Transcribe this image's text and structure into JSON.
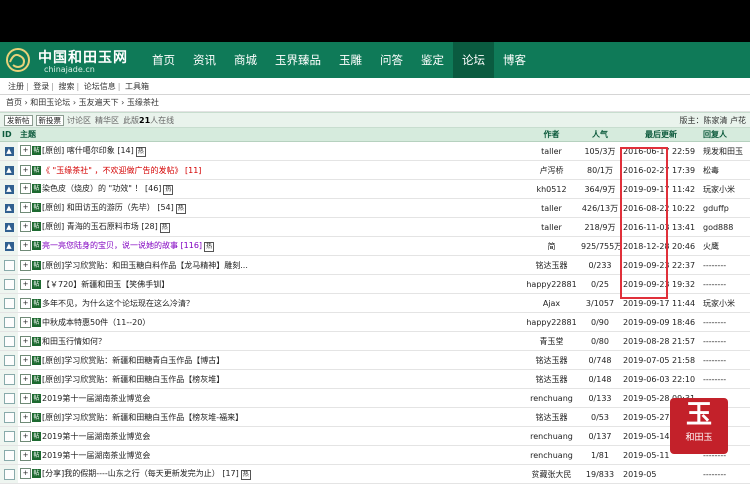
{
  "site": {
    "logo_cn": "中国和田玉网",
    "logo_en": "chinajade.cn"
  },
  "nav": [
    "首页",
    "资讯",
    "商城",
    "玉界臻品",
    "玉雕",
    "问答",
    "鉴定",
    "论坛",
    "博客"
  ],
  "subnav": [
    "注册",
    "登录",
    "搜索",
    "论坛信息",
    "工具箱"
  ],
  "breadcrumb": "首页 › 和田玉论坛 › 玉友遍天下 › 玉缘茶社",
  "toolbar": {
    "new_post": "发新帖",
    "new_vote": "新投票",
    "area_label": "讨论区",
    "essence_label": "精华区",
    "online_prefix": "此版",
    "online_count": "21",
    "online_suffix": "人在线",
    "moderator": "版主：陈家清 卢花"
  },
  "columns": {
    "id": "ID",
    "topic": "主题",
    "author": "作者",
    "views": "人气",
    "last_update": "最后更新",
    "last_reply": "回复人"
  },
  "rows": [
    {
      "icon": "pin",
      "title": "[原创] 喀什噶尔印象 [14]",
      "color": "normal",
      "hot": true,
      "author": "taller",
      "views": "105/3万",
      "date": "2016-06-17 22:59",
      "replier": "规发和田玉"
    },
    {
      "icon": "pin",
      "title": "《 \"玉缘茶社\" ，不欢迎做广告的发帖》 [11]",
      "color": "red",
      "hot": false,
      "author": "卢泻桥",
      "views": "80/1万",
      "date": "2016-02-27 17:39",
      "replier": "松毒"
    },
    {
      "icon": "pin",
      "title": "染色皮（烧皮）的 \"功效\" ！ [46]",
      "color": "normal",
      "hot": true,
      "author": "kh0512",
      "views": "364/9万",
      "date": "2019-09-17 11:42",
      "replier": "玩家小米"
    },
    {
      "icon": "pin",
      "title": "[原创] 和田访玉的游历（先毕） [54]",
      "color": "normal",
      "hot": true,
      "author": "taller",
      "views": "426/13万",
      "date": "2016-08-22 10:22",
      "replier": "gduffp"
    },
    {
      "icon": "pin",
      "title": "[原创] 青海的玉石原料市场 [28]",
      "color": "normal",
      "hot": true,
      "author": "taller",
      "views": "218/9万",
      "date": "2016-11-03 13:41",
      "replier": "god888"
    },
    {
      "icon": "pin",
      "title": "亮一亮您陆身的宝贝，说一说她的故事 [116]",
      "color": "purple",
      "hot": true,
      "author": "简",
      "views": "925/755万",
      "date": "2018-12-28 20:46",
      "replier": "火鹰"
    },
    {
      "icon": "doc",
      "title": "[原创]学习欣赏贴：和田玉糖白料作品【龙马精神】雕刻...",
      "color": "normal",
      "hot": false,
      "author": "铭达玉器",
      "views": "0/233",
      "date": "2019-09-23 22:37",
      "replier": "--------"
    },
    {
      "icon": "doc",
      "title": "【￥720】新疆和田玉【笑佛手钏】",
      "color": "normal",
      "hot": false,
      "author": "happy22881",
      "views": "0/25",
      "date": "2019-09-23 19:32",
      "replier": "--------"
    },
    {
      "icon": "doc",
      "title": "多年不见，为什么这个论坛现在这么冷清？",
      "color": "normal",
      "hot": false,
      "author": "Ajax",
      "views": "3/1057",
      "date": "2019-09-17 11:44",
      "replier": "玩家小米"
    },
    {
      "icon": "doc",
      "title": "中秋成本特惠50件（11--20）",
      "color": "normal",
      "hot": false,
      "author": "happy22881",
      "views": "0/90",
      "date": "2019-09-09 18:46",
      "replier": "--------"
    },
    {
      "icon": "doc",
      "title": "和田玉行情如何？",
      "color": "normal",
      "hot": false,
      "author": "青玉堂",
      "views": "0/80",
      "date": "2019-08-28 21:57",
      "replier": "--------"
    },
    {
      "icon": "doc",
      "title": "[原创]学习欣赏贴：新疆和田糖青白玉作品【博古】",
      "color": "normal",
      "hot": false,
      "author": "铭达玉器",
      "views": "0/748",
      "date": "2019-07-05 21:58",
      "replier": "--------"
    },
    {
      "icon": "doc",
      "title": "[原创]学习欣赏贴：新疆和田糖白玉作品【榜灰堆】",
      "color": "normal",
      "hot": false,
      "author": "铭达玉器",
      "views": "0/148",
      "date": "2019-06-03 22:10",
      "replier": "--------"
    },
    {
      "icon": "doc",
      "title": "2019第十一届湖南茶业博览会",
      "color": "normal",
      "hot": false,
      "author": "renchuang",
      "views": "0/133",
      "date": "2019-05-28 09:31",
      "replier": "--------"
    },
    {
      "icon": "doc",
      "title": "[原创]学习欣赏贴：新疆和田糖白玉作品【榜灰堆-福来】",
      "color": "normal",
      "hot": false,
      "author": "铭达玉器",
      "views": "0/53",
      "date": "2019-05-27 22:02",
      "replier": "--------"
    },
    {
      "icon": "doc",
      "title": "2019第十一届湖南茶业博览会",
      "color": "normal",
      "hot": false,
      "author": "renchuang",
      "views": "0/137",
      "date": "2019-05-14",
      "replier": "--------"
    },
    {
      "icon": "doc",
      "title": "2019第十一届湖南茶业博览会",
      "color": "normal",
      "hot": false,
      "author": "renchuang",
      "views": "1/81",
      "date": "2019-05-11",
      "replier": "--------"
    },
    {
      "icon": "doc",
      "title": "[分享]我的假期----山东之行（每天更新发完为止） [17]",
      "color": "normal",
      "hot": true,
      "author": "贫藏张大民",
      "views": "19/833",
      "date": "2019-05",
      "replier": "--------"
    }
  ],
  "stamp": {
    "big": "玉",
    "small": "和田玉"
  }
}
